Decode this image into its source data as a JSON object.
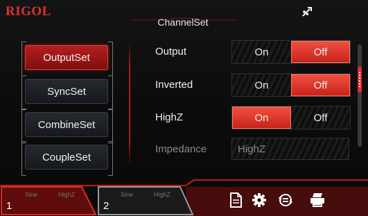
{
  "header": {
    "brand": "RIGOL",
    "title": "ChannelSet"
  },
  "menu": {
    "items": [
      {
        "label": "OutputSet",
        "active": true
      },
      {
        "label": "SyncSet",
        "active": false
      },
      {
        "label": "CombineSet",
        "active": false
      },
      {
        "label": "CoupleSet",
        "active": false
      }
    ]
  },
  "params": {
    "output": {
      "label": "Output",
      "on": "On",
      "off": "Off",
      "selected": "Off"
    },
    "inverted": {
      "label": "Inverted",
      "on": "On",
      "off": "Off",
      "selected": "Off"
    },
    "highz": {
      "label": "HighZ",
      "on": "On",
      "off": "Off",
      "selected": "On"
    },
    "impedance": {
      "label": "Impedance",
      "value": "HighZ"
    }
  },
  "channels": [
    {
      "number": "1",
      "waveform": "Sine",
      "load": "HighZ",
      "active": true
    },
    {
      "number": "2",
      "waveform": "Sine",
      "load": "HighZ",
      "active": false
    }
  ],
  "icons": {
    "usb": "usb-icon",
    "toolbar": [
      "document-icon",
      "gear-icon",
      "sync-icon",
      "printer-icon"
    ]
  },
  "colors": {
    "accent": "#e03030",
    "selected_option": "#e63b2e",
    "text": "#f0f0f0",
    "disabled_text": "#8a8a8a"
  }
}
